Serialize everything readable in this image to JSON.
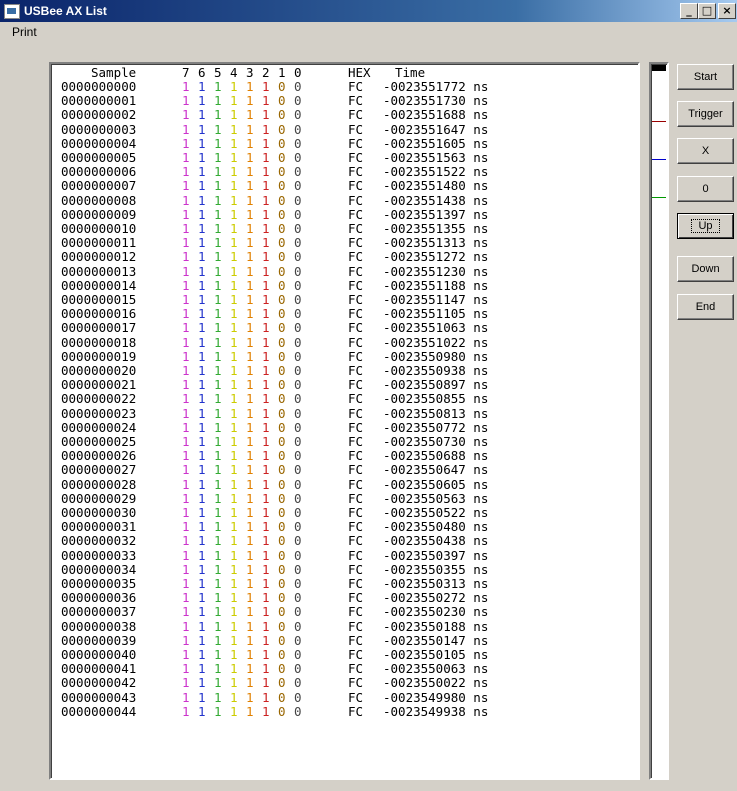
{
  "window": {
    "title": "USBee AX List",
    "controls": {
      "minimize": "_",
      "maximize": "□",
      "close": "×"
    }
  },
  "menu": {
    "print": "Print"
  },
  "list": {
    "headers": {
      "sample": "Sample",
      "bits": [
        "7",
        "6",
        "5",
        "4",
        "3",
        "2",
        "1",
        "0"
      ],
      "hex": "HEX",
      "time": "Time"
    },
    "bit_colors": [
      "#cc33cc",
      "#2233cc",
      "#33aa33",
      "#cccc00",
      "#e08000",
      "#cc2222",
      "#996600",
      "#444444"
    ],
    "rows": [
      {
        "sample": "0000000000",
        "bits": [
          "1",
          "1",
          "1",
          "1",
          "1",
          "1",
          "0",
          "0"
        ],
        "hex": "FC",
        "time": "-0023551772 ns"
      },
      {
        "sample": "0000000001",
        "bits": [
          "1",
          "1",
          "1",
          "1",
          "1",
          "1",
          "0",
          "0"
        ],
        "hex": "FC",
        "time": "-0023551730 ns"
      },
      {
        "sample": "0000000002",
        "bits": [
          "1",
          "1",
          "1",
          "1",
          "1",
          "1",
          "0",
          "0"
        ],
        "hex": "FC",
        "time": "-0023551688 ns"
      },
      {
        "sample": "0000000003",
        "bits": [
          "1",
          "1",
          "1",
          "1",
          "1",
          "1",
          "0",
          "0"
        ],
        "hex": "FC",
        "time": "-0023551647 ns"
      },
      {
        "sample": "0000000004",
        "bits": [
          "1",
          "1",
          "1",
          "1",
          "1",
          "1",
          "0",
          "0"
        ],
        "hex": "FC",
        "time": "-0023551605 ns"
      },
      {
        "sample": "0000000005",
        "bits": [
          "1",
          "1",
          "1",
          "1",
          "1",
          "1",
          "0",
          "0"
        ],
        "hex": "FC",
        "time": "-0023551563 ns"
      },
      {
        "sample": "0000000006",
        "bits": [
          "1",
          "1",
          "1",
          "1",
          "1",
          "1",
          "0",
          "0"
        ],
        "hex": "FC",
        "time": "-0023551522 ns"
      },
      {
        "sample": "0000000007",
        "bits": [
          "1",
          "1",
          "1",
          "1",
          "1",
          "1",
          "0",
          "0"
        ],
        "hex": "FC",
        "time": "-0023551480 ns"
      },
      {
        "sample": "0000000008",
        "bits": [
          "1",
          "1",
          "1",
          "1",
          "1",
          "1",
          "0",
          "0"
        ],
        "hex": "FC",
        "time": "-0023551438 ns"
      },
      {
        "sample": "0000000009",
        "bits": [
          "1",
          "1",
          "1",
          "1",
          "1",
          "1",
          "0",
          "0"
        ],
        "hex": "FC",
        "time": "-0023551397 ns"
      },
      {
        "sample": "0000000010",
        "bits": [
          "1",
          "1",
          "1",
          "1",
          "1",
          "1",
          "0",
          "0"
        ],
        "hex": "FC",
        "time": "-0023551355 ns"
      },
      {
        "sample": "0000000011",
        "bits": [
          "1",
          "1",
          "1",
          "1",
          "1",
          "1",
          "0",
          "0"
        ],
        "hex": "FC",
        "time": "-0023551313 ns"
      },
      {
        "sample": "0000000012",
        "bits": [
          "1",
          "1",
          "1",
          "1",
          "1",
          "1",
          "0",
          "0"
        ],
        "hex": "FC",
        "time": "-0023551272 ns"
      },
      {
        "sample": "0000000013",
        "bits": [
          "1",
          "1",
          "1",
          "1",
          "1",
          "1",
          "0",
          "0"
        ],
        "hex": "FC",
        "time": "-0023551230 ns"
      },
      {
        "sample": "0000000014",
        "bits": [
          "1",
          "1",
          "1",
          "1",
          "1",
          "1",
          "0",
          "0"
        ],
        "hex": "FC",
        "time": "-0023551188 ns"
      },
      {
        "sample": "0000000015",
        "bits": [
          "1",
          "1",
          "1",
          "1",
          "1",
          "1",
          "0",
          "0"
        ],
        "hex": "FC",
        "time": "-0023551147 ns"
      },
      {
        "sample": "0000000016",
        "bits": [
          "1",
          "1",
          "1",
          "1",
          "1",
          "1",
          "0",
          "0"
        ],
        "hex": "FC",
        "time": "-0023551105 ns"
      },
      {
        "sample": "0000000017",
        "bits": [
          "1",
          "1",
          "1",
          "1",
          "1",
          "1",
          "0",
          "0"
        ],
        "hex": "FC",
        "time": "-0023551063 ns"
      },
      {
        "sample": "0000000018",
        "bits": [
          "1",
          "1",
          "1",
          "1",
          "1",
          "1",
          "0",
          "0"
        ],
        "hex": "FC",
        "time": "-0023551022 ns"
      },
      {
        "sample": "0000000019",
        "bits": [
          "1",
          "1",
          "1",
          "1",
          "1",
          "1",
          "0",
          "0"
        ],
        "hex": "FC",
        "time": "-0023550980 ns"
      },
      {
        "sample": "0000000020",
        "bits": [
          "1",
          "1",
          "1",
          "1",
          "1",
          "1",
          "0",
          "0"
        ],
        "hex": "FC",
        "time": "-0023550938 ns"
      },
      {
        "sample": "0000000021",
        "bits": [
          "1",
          "1",
          "1",
          "1",
          "1",
          "1",
          "0",
          "0"
        ],
        "hex": "FC",
        "time": "-0023550897 ns"
      },
      {
        "sample": "0000000022",
        "bits": [
          "1",
          "1",
          "1",
          "1",
          "1",
          "1",
          "0",
          "0"
        ],
        "hex": "FC",
        "time": "-0023550855 ns"
      },
      {
        "sample": "0000000023",
        "bits": [
          "1",
          "1",
          "1",
          "1",
          "1",
          "1",
          "0",
          "0"
        ],
        "hex": "FC",
        "time": "-0023550813 ns"
      },
      {
        "sample": "0000000024",
        "bits": [
          "1",
          "1",
          "1",
          "1",
          "1",
          "1",
          "0",
          "0"
        ],
        "hex": "FC",
        "time": "-0023550772 ns"
      },
      {
        "sample": "0000000025",
        "bits": [
          "1",
          "1",
          "1",
          "1",
          "1",
          "1",
          "0",
          "0"
        ],
        "hex": "FC",
        "time": "-0023550730 ns"
      },
      {
        "sample": "0000000026",
        "bits": [
          "1",
          "1",
          "1",
          "1",
          "1",
          "1",
          "0",
          "0"
        ],
        "hex": "FC",
        "time": "-0023550688 ns"
      },
      {
        "sample": "0000000027",
        "bits": [
          "1",
          "1",
          "1",
          "1",
          "1",
          "1",
          "0",
          "0"
        ],
        "hex": "FC",
        "time": "-0023550647 ns"
      },
      {
        "sample": "0000000028",
        "bits": [
          "1",
          "1",
          "1",
          "1",
          "1",
          "1",
          "0",
          "0"
        ],
        "hex": "FC",
        "time": "-0023550605 ns"
      },
      {
        "sample": "0000000029",
        "bits": [
          "1",
          "1",
          "1",
          "1",
          "1",
          "1",
          "0",
          "0"
        ],
        "hex": "FC",
        "time": "-0023550563 ns"
      },
      {
        "sample": "0000000030",
        "bits": [
          "1",
          "1",
          "1",
          "1",
          "1",
          "1",
          "0",
          "0"
        ],
        "hex": "FC",
        "time": "-0023550522 ns"
      },
      {
        "sample": "0000000031",
        "bits": [
          "1",
          "1",
          "1",
          "1",
          "1",
          "1",
          "0",
          "0"
        ],
        "hex": "FC",
        "time": "-0023550480 ns"
      },
      {
        "sample": "0000000032",
        "bits": [
          "1",
          "1",
          "1",
          "1",
          "1",
          "1",
          "0",
          "0"
        ],
        "hex": "FC",
        "time": "-0023550438 ns"
      },
      {
        "sample": "0000000033",
        "bits": [
          "1",
          "1",
          "1",
          "1",
          "1",
          "1",
          "0",
          "0"
        ],
        "hex": "FC",
        "time": "-0023550397 ns"
      },
      {
        "sample": "0000000034",
        "bits": [
          "1",
          "1",
          "1",
          "1",
          "1",
          "1",
          "0",
          "0"
        ],
        "hex": "FC",
        "time": "-0023550355 ns"
      },
      {
        "sample": "0000000035",
        "bits": [
          "1",
          "1",
          "1",
          "1",
          "1",
          "1",
          "0",
          "0"
        ],
        "hex": "FC",
        "time": "-0023550313 ns"
      },
      {
        "sample": "0000000036",
        "bits": [
          "1",
          "1",
          "1",
          "1",
          "1",
          "1",
          "0",
          "0"
        ],
        "hex": "FC",
        "time": "-0023550272 ns"
      },
      {
        "sample": "0000000037",
        "bits": [
          "1",
          "1",
          "1",
          "1",
          "1",
          "1",
          "0",
          "0"
        ],
        "hex": "FC",
        "time": "-0023550230 ns"
      },
      {
        "sample": "0000000038",
        "bits": [
          "1",
          "1",
          "1",
          "1",
          "1",
          "1",
          "0",
          "0"
        ],
        "hex": "FC",
        "time": "-0023550188 ns"
      },
      {
        "sample": "0000000039",
        "bits": [
          "1",
          "1",
          "1",
          "1",
          "1",
          "1",
          "0",
          "0"
        ],
        "hex": "FC",
        "time": "-0023550147 ns"
      },
      {
        "sample": "0000000040",
        "bits": [
          "1",
          "1",
          "1",
          "1",
          "1",
          "1",
          "0",
          "0"
        ],
        "hex": "FC",
        "time": "-0023550105 ns"
      },
      {
        "sample": "0000000041",
        "bits": [
          "1",
          "1",
          "1",
          "1",
          "1",
          "1",
          "0",
          "0"
        ],
        "hex": "FC",
        "time": "-0023550063 ns"
      },
      {
        "sample": "0000000042",
        "bits": [
          "1",
          "1",
          "1",
          "1",
          "1",
          "1",
          "0",
          "0"
        ],
        "hex": "FC",
        "time": "-0023550022 ns"
      },
      {
        "sample": "0000000043",
        "bits": [
          "1",
          "1",
          "1",
          "1",
          "1",
          "1",
          "0",
          "0"
        ],
        "hex": "FC",
        "time": "-0023549980 ns"
      },
      {
        "sample": "0000000044",
        "bits": [
          "1",
          "1",
          "1",
          "1",
          "1",
          "1",
          "0",
          "0"
        ],
        "hex": "FC",
        "time": "-0023549938 ns"
      }
    ]
  },
  "scroll_panel": {
    "marker_colors": [
      "#990000",
      "#0000cc",
      "#009900"
    ]
  },
  "buttons": [
    {
      "id": "start",
      "label": "Start"
    },
    {
      "id": "trigger",
      "label": "Trigger"
    },
    {
      "id": "x",
      "label": "X"
    },
    {
      "id": "zero",
      "label": "0"
    },
    {
      "id": "up",
      "label": "Up"
    },
    {
      "id": "down",
      "label": "Down"
    },
    {
      "id": "end",
      "label": "End"
    }
  ]
}
